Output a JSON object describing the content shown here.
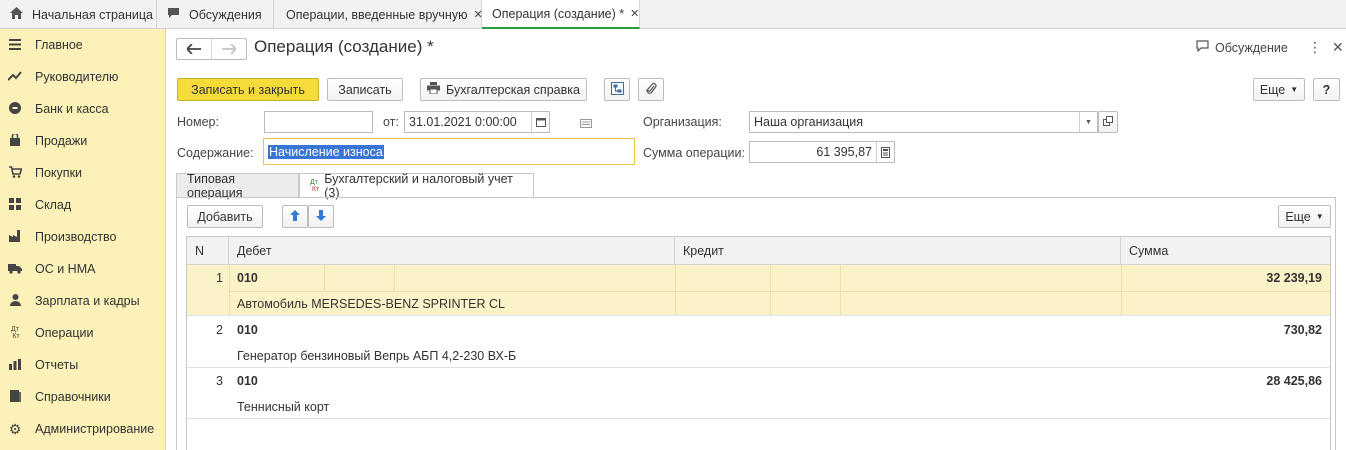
{
  "top_tabs": [
    {
      "label": "Начальная страница",
      "icon": "home-icon"
    },
    {
      "label": "Обсуждения",
      "icon": "chat-icon"
    },
    {
      "label": "Операции, введенные вручную",
      "icon": "close-icon"
    },
    {
      "label": "Операция (создание) *",
      "icon": "close-icon"
    }
  ],
  "sidebar": {
    "items": [
      {
        "label": "Главное",
        "icon": "menu-icon"
      },
      {
        "label": "Руководителю",
        "icon": "trend-icon"
      },
      {
        "label": "Банк и касса",
        "icon": "coin-icon"
      },
      {
        "label": "Продажи",
        "icon": "bag-icon"
      },
      {
        "label": "Покупки",
        "icon": "cart-icon"
      },
      {
        "label": "Склад",
        "icon": "warehouse-icon"
      },
      {
        "label": "Производство",
        "icon": "factory-icon"
      },
      {
        "label": "ОС и НМА",
        "icon": "truck-icon"
      },
      {
        "label": "Зарплата и кадры",
        "icon": "person-icon"
      },
      {
        "label": "Операции",
        "icon": "dt-kt-icon"
      },
      {
        "label": "Отчеты",
        "icon": "bar-chart-icon"
      },
      {
        "label": "Справочники",
        "icon": "book-icon"
      },
      {
        "label": "Администрирование",
        "icon": "gear-icon"
      }
    ]
  },
  "header": {
    "title": "Операция (создание) *",
    "discussion_label": "Обсуждение"
  },
  "toolbar": {
    "save_close_label": "Записать и закрыть",
    "save_label": "Записать",
    "accounting_ref_label": "Бухгалтерская справка",
    "more_label": "Еще",
    "help_label": "?"
  },
  "form": {
    "number_label": "Номер:",
    "number_value": "",
    "date_label": "от:",
    "date_value": "31.01.2021  0:00:00",
    "org_label": "Организация:",
    "org_value": "Наша организация",
    "content_label": "Содержание:",
    "content_value": "Начисление износа",
    "sum_label": "Сумма операции:",
    "sum_value": "61 395,87"
  },
  "form_tabs": [
    {
      "label": "Типовая операция"
    },
    {
      "label": "Бухгалтерский и налоговый учет (3)",
      "icon_dt": "Дт",
      "icon_kt": "Кт"
    }
  ],
  "table_toolbar": {
    "add_label": "Добавить",
    "more_label": "Еще"
  },
  "table": {
    "columns": [
      "N",
      "Дебет",
      "Кредит",
      "Сумма"
    ],
    "rows": [
      {
        "n": "1",
        "debit": "010",
        "debit_sub": "Автомобиль MERSEDES-BENZ SPRINTER CL",
        "sum": "32 239,19"
      },
      {
        "n": "2",
        "debit": "010",
        "debit_sub": "Генератор бензиновый Вепрь АБП 4,2-230 ВХ-Б",
        "sum": "730,82"
      },
      {
        "n": "3",
        "debit": "010",
        "debit_sub": "Теннисный корт",
        "sum": "28 425,86"
      }
    ]
  },
  "colors": {
    "sidebar_bg": "#fbf1b9",
    "primary_button": "#f5dc3b",
    "active_tab_underline": "#2a9b3e",
    "selected_row": "#fcf2c8",
    "selection": "#3875d7"
  }
}
